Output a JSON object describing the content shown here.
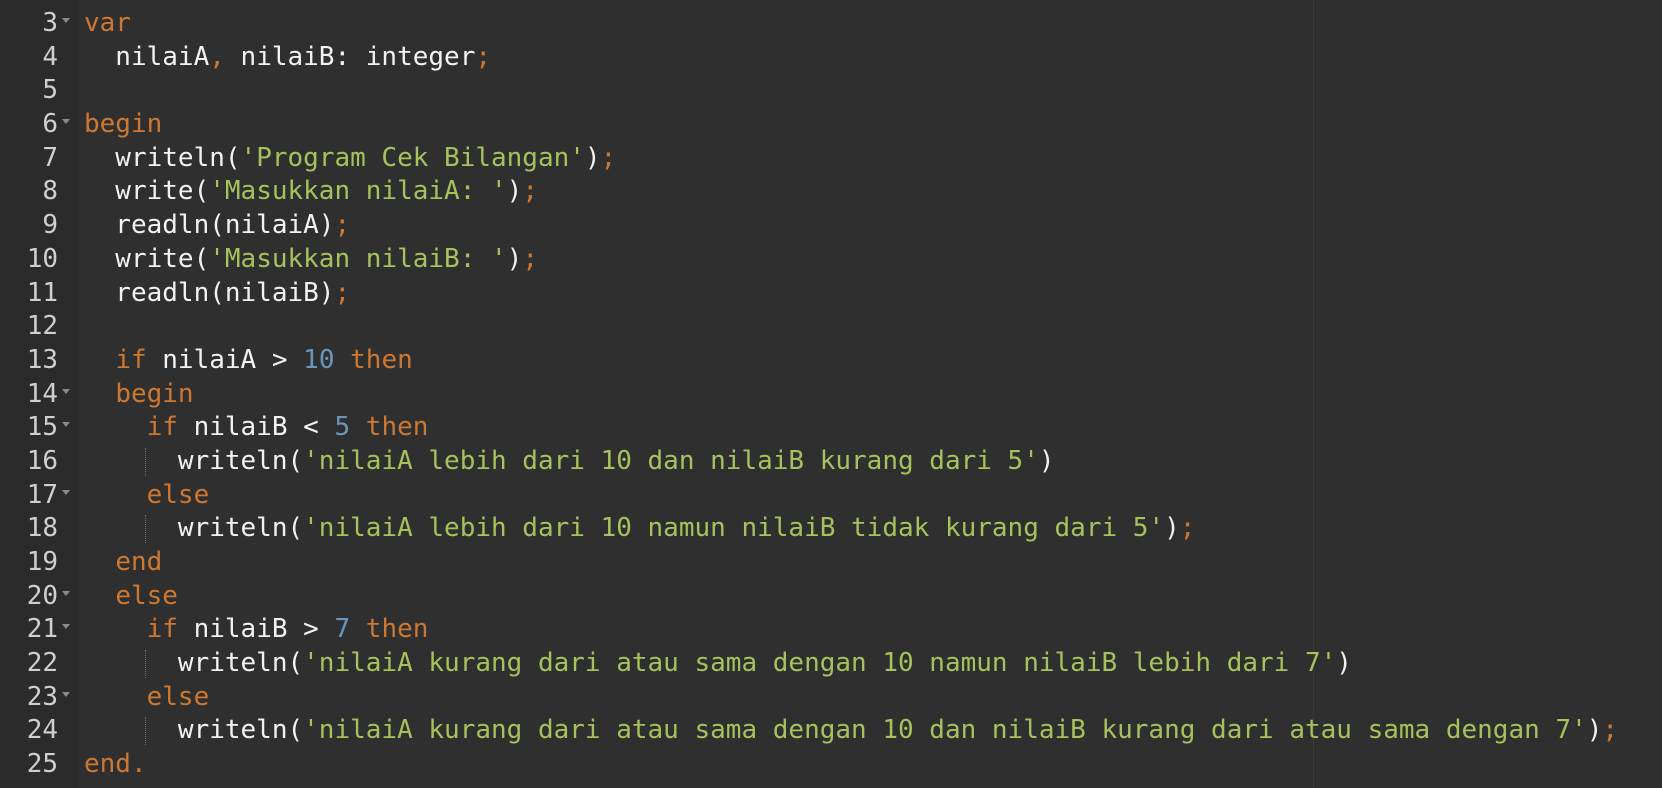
{
  "editor": {
    "partial_line_number": "2",
    "lines": [
      {
        "number": "3",
        "fold": true,
        "guide": false,
        "tokens": [
          {
            "t": "var",
            "c": "kw"
          }
        ]
      },
      {
        "number": "4",
        "fold": false,
        "guide": false,
        "tokens": [
          {
            "t": "  nilaiA",
            "c": "id"
          },
          {
            "t": ",",
            "c": "punct"
          },
          {
            "t": " nilaiB: integer",
            "c": "id"
          },
          {
            "t": ";",
            "c": "punct"
          }
        ]
      },
      {
        "number": "5",
        "fold": false,
        "guide": false,
        "tokens": []
      },
      {
        "number": "6",
        "fold": true,
        "guide": false,
        "tokens": [
          {
            "t": "begin",
            "c": "kw"
          }
        ]
      },
      {
        "number": "7",
        "fold": false,
        "guide": false,
        "tokens": [
          {
            "t": "  writeln(",
            "c": "id"
          },
          {
            "t": "'Program Cek Bilangan'",
            "c": "str"
          },
          {
            "t": ")",
            "c": "id"
          },
          {
            "t": ";",
            "c": "punct"
          }
        ]
      },
      {
        "number": "8",
        "fold": false,
        "guide": false,
        "tokens": [
          {
            "t": "  write(",
            "c": "id"
          },
          {
            "t": "'Masukkan nilaiA: '",
            "c": "str"
          },
          {
            "t": ")",
            "c": "id"
          },
          {
            "t": ";",
            "c": "punct"
          }
        ]
      },
      {
        "number": "9",
        "fold": false,
        "guide": false,
        "tokens": [
          {
            "t": "  readln(nilaiA)",
            "c": "id"
          },
          {
            "t": ";",
            "c": "punct"
          }
        ]
      },
      {
        "number": "10",
        "fold": false,
        "guide": false,
        "tokens": [
          {
            "t": "  write(",
            "c": "id"
          },
          {
            "t": "'Masukkan nilaiB: '",
            "c": "str"
          },
          {
            "t": ")",
            "c": "id"
          },
          {
            "t": ";",
            "c": "punct"
          }
        ]
      },
      {
        "number": "11",
        "fold": false,
        "guide": false,
        "tokens": [
          {
            "t": "  readln(nilaiB)",
            "c": "id"
          },
          {
            "t": ";",
            "c": "punct"
          }
        ]
      },
      {
        "number": "12",
        "fold": false,
        "guide": false,
        "tokens": []
      },
      {
        "number": "13",
        "fold": false,
        "guide": false,
        "tokens": [
          {
            "t": "  ",
            "c": "id"
          },
          {
            "t": "if",
            "c": "kw"
          },
          {
            "t": " nilaiA > ",
            "c": "id"
          },
          {
            "t": "10",
            "c": "num"
          },
          {
            "t": " ",
            "c": "id"
          },
          {
            "t": "then",
            "c": "kw"
          }
        ]
      },
      {
        "number": "14",
        "fold": true,
        "guide": false,
        "tokens": [
          {
            "t": "  ",
            "c": "id"
          },
          {
            "t": "begin",
            "c": "kw"
          }
        ]
      },
      {
        "number": "15",
        "fold": true,
        "guide": false,
        "tokens": [
          {
            "t": "    ",
            "c": "id"
          },
          {
            "t": "if",
            "c": "kw"
          },
          {
            "t": " nilaiB < ",
            "c": "id"
          },
          {
            "t": "5",
            "c": "num"
          },
          {
            "t": " ",
            "c": "id"
          },
          {
            "t": "then",
            "c": "kw"
          }
        ]
      },
      {
        "number": "16",
        "fold": false,
        "guide": true,
        "tokens": [
          {
            "t": "      writeln(",
            "c": "id"
          },
          {
            "t": "'nilaiA lebih dari 10 dan nilaiB kurang dari 5'",
            "c": "str"
          },
          {
            "t": ")",
            "c": "id"
          }
        ]
      },
      {
        "number": "17",
        "fold": true,
        "guide": false,
        "tokens": [
          {
            "t": "    ",
            "c": "id"
          },
          {
            "t": "else",
            "c": "kw"
          }
        ]
      },
      {
        "number": "18",
        "fold": false,
        "guide": true,
        "tokens": [
          {
            "t": "      writeln(",
            "c": "id"
          },
          {
            "t": "'nilaiA lebih dari 10 namun nilaiB tidak kurang dari 5'",
            "c": "str"
          },
          {
            "t": ")",
            "c": "id"
          },
          {
            "t": ";",
            "c": "punct"
          }
        ]
      },
      {
        "number": "19",
        "fold": false,
        "guide": false,
        "tokens": [
          {
            "t": "  ",
            "c": "id"
          },
          {
            "t": "end",
            "c": "kw"
          }
        ]
      },
      {
        "number": "20",
        "fold": true,
        "guide": false,
        "tokens": [
          {
            "t": "  ",
            "c": "id"
          },
          {
            "t": "else",
            "c": "kw"
          }
        ]
      },
      {
        "number": "21",
        "fold": true,
        "guide": false,
        "tokens": [
          {
            "t": "    ",
            "c": "id"
          },
          {
            "t": "if",
            "c": "kw"
          },
          {
            "t": " nilaiB > ",
            "c": "id"
          },
          {
            "t": "7",
            "c": "num"
          },
          {
            "t": " ",
            "c": "id"
          },
          {
            "t": "then",
            "c": "kw"
          }
        ]
      },
      {
        "number": "22",
        "fold": false,
        "guide": true,
        "tokens": [
          {
            "t": "      writeln(",
            "c": "id"
          },
          {
            "t": "'nilaiA kurang dari atau sama dengan 10 namun nilaiB lebih dari 7'",
            "c": "str"
          },
          {
            "t": ")",
            "c": "id"
          }
        ]
      },
      {
        "number": "23",
        "fold": true,
        "guide": false,
        "tokens": [
          {
            "t": "    ",
            "c": "id"
          },
          {
            "t": "else",
            "c": "kw"
          }
        ]
      },
      {
        "number": "24",
        "fold": false,
        "guide": true,
        "tokens": [
          {
            "t": "      writeln(",
            "c": "id"
          },
          {
            "t": "'nilaiA kurang dari atau sama dengan 10 dan nilaiB kurang dari atau sama dengan 7'",
            "c": "str"
          },
          {
            "t": ")",
            "c": "id"
          },
          {
            "t": ";",
            "c": "punct"
          }
        ]
      },
      {
        "number": "25",
        "fold": false,
        "guide": false,
        "tokens": [
          {
            "t": "end",
            "c": "kw"
          },
          {
            "t": ".",
            "c": "punct"
          }
        ]
      }
    ]
  },
  "colors": {
    "background": "#2f2f2f",
    "keyword": "#cc7832",
    "string": "#a5c25c",
    "number": "#6897bb",
    "identifier": "#f2f2f2",
    "line_number": "#cfcfcf"
  }
}
